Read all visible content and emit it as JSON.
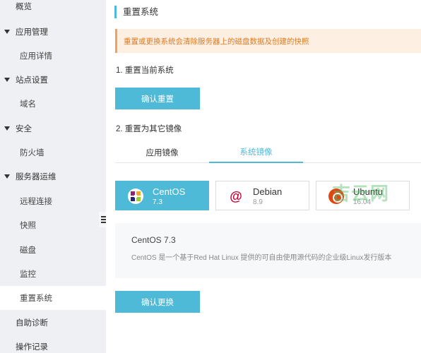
{
  "sidebar": {
    "items": [
      {
        "label": "概览"
      },
      {
        "label": "应用管理"
      },
      {
        "label": "应用详情"
      },
      {
        "label": "站点设置"
      },
      {
        "label": "域名"
      },
      {
        "label": "安全"
      },
      {
        "label": "防火墙"
      },
      {
        "label": "服务器运维"
      },
      {
        "label": "远程连接"
      },
      {
        "label": "快照"
      },
      {
        "label": "磁盘"
      },
      {
        "label": "监控"
      },
      {
        "label": "重置系统"
      },
      {
        "label": "自助诊断"
      },
      {
        "label": "操作记录"
      }
    ]
  },
  "main": {
    "title": "重置系统",
    "alert": "重置或更换系统会清除服务器上的磁盘数据及创建的快照",
    "section1": "1. 重置当前系统",
    "reset_button": "确认重置",
    "section2": "2. 重置为其它镜像",
    "tabs": [
      {
        "label": "应用镜像"
      },
      {
        "label": "系统镜像"
      }
    ],
    "os_options": [
      {
        "name": "CentOS",
        "version": "7.3",
        "icon": "centos-icon"
      },
      {
        "name": "Debian",
        "version": "8.9",
        "icon": "debian-icon"
      },
      {
        "name": "Ubuntu",
        "version": "16.04",
        "icon": "ubuntu-icon"
      }
    ],
    "description": {
      "title": "CentOS 7.3",
      "text": "CentOS 是一个基于Red Hat Linux 提供的可自由使用源代码的企业级Linux发行版本"
    },
    "change_button": "确认更换"
  },
  "watermark": "吉云网",
  "colors": {
    "accent": "#4fbad8",
    "alert_bg": "#fdefe2",
    "alert_text": "#e07b1f",
    "sidebar_bg": "#eef0f3"
  }
}
